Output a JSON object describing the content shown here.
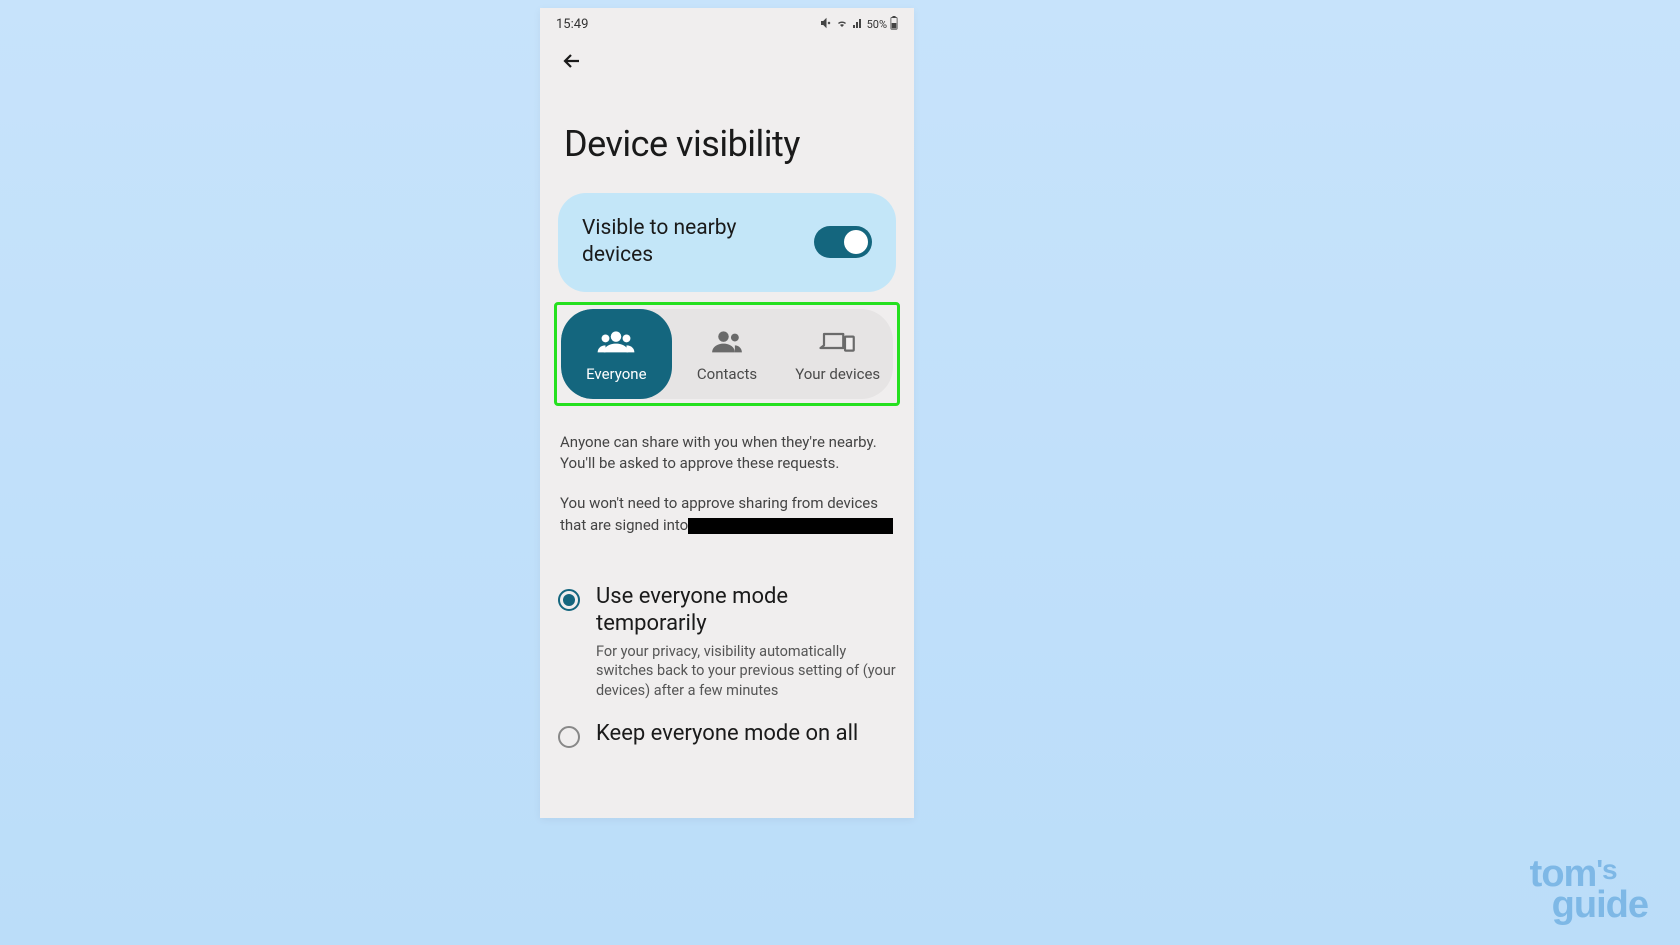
{
  "statusBar": {
    "time": "15:49",
    "battery": "50%"
  },
  "page": {
    "title": "Device visibility"
  },
  "toggle": {
    "label": "Visible to nearby devices",
    "on": true
  },
  "segments": {
    "everyone": "Everyone",
    "contacts": "Contacts",
    "yourDevices": "Your devices",
    "active": "everyone"
  },
  "description": {
    "para1": "Anyone can share with you when they're nearby. You'll be asked to approve these requests.",
    "para2prefix": "You won't need to approve sharing from devices that are signed into"
  },
  "radios": {
    "opt1": {
      "title": "Use everyone mode temporarily",
      "desc": "For your privacy, visibility automatically switches back to your previous setting of (your devices) after a few minutes"
    },
    "opt2": {
      "title": "Keep everyone mode on all"
    }
  },
  "watermark": {
    "line1": "tom",
    "line2": "guide"
  }
}
